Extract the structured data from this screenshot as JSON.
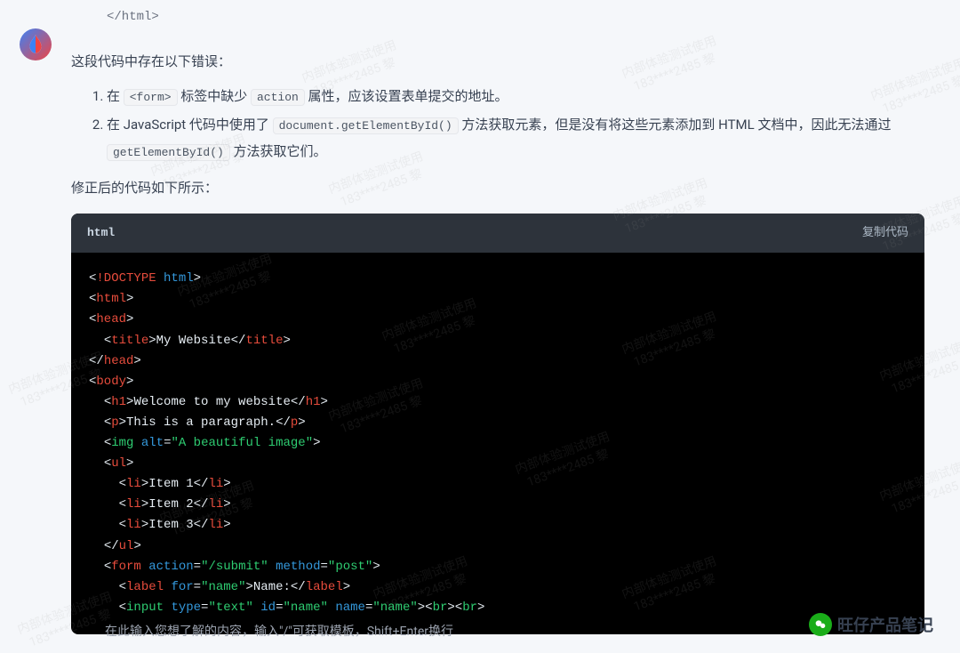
{
  "prev_code_tail": "</html>",
  "intro": "这段代码中存在以下错误：",
  "errors": {
    "item1": {
      "pre": "在 ",
      "code1": "<form>",
      "mid1": " 标签中缺少 ",
      "code2": "action",
      "post": " 属性，应该设置表单提交的地址。"
    },
    "item2": {
      "pre": "在 JavaScript 代码中使用了 ",
      "code1": "document.getElementById()",
      "mid1": " 方法获取元素，但是没有将这些元素添加到 HTML 文档中，因此无法通过 ",
      "code2": "getElementById()",
      "post": " 方法获取它们。"
    }
  },
  "fix_intro": "修正后的代码如下所示：",
  "code_header": {
    "lang": "html",
    "copy": "复制代码"
  },
  "code": {
    "l1_doctype": "!DOCTYPE",
    "l1_html": "html",
    "l2_html": "html",
    "l3_head": "head",
    "l4_title": "title",
    "l4_text": "My Website",
    "l5_head": "head",
    "l6_body": "body",
    "l7_h1": "h1",
    "l7_text": "Welcome to my website",
    "l8_p": "p",
    "l8_text": "This is a paragraph.",
    "l9_img": "img",
    "l9_alt_attr": "alt",
    "l9_alt_val": "\"A beautiful image\"",
    "l10_ul": "ul",
    "l11_li": "li",
    "l11_text": "Item 1",
    "l12_li": "li",
    "l12_text": "Item 2",
    "l13_li": "li",
    "l13_text": "Item 3",
    "l14_ul": "ul",
    "l15_form": "form",
    "l15_action_attr": "action",
    "l15_action_val": "\"/submit\"",
    "l15_method_attr": "method",
    "l15_method_val": "\"post\"",
    "l16_label": "label",
    "l16_for_attr": "for",
    "l16_for_val": "\"name\"",
    "l16_text": "Name:",
    "l17_input": "input",
    "l17_type_attr": "type",
    "l17_type_val": "\"text\"",
    "l17_id_attr": "id",
    "l17_id_val": "\"name\"",
    "l17_name_attr": "name",
    "l17_name_val": "\"name\"",
    "l17_br": "br"
  },
  "input_placeholder": "在此输入您想了解的内容，输入\"/\"可获取模板，Shift+Enter换行",
  "footer_brand": "旺仔产品笔记",
  "watermark": {
    "line1": "内部体验测试使用",
    "line2": "183****2485 黎"
  }
}
